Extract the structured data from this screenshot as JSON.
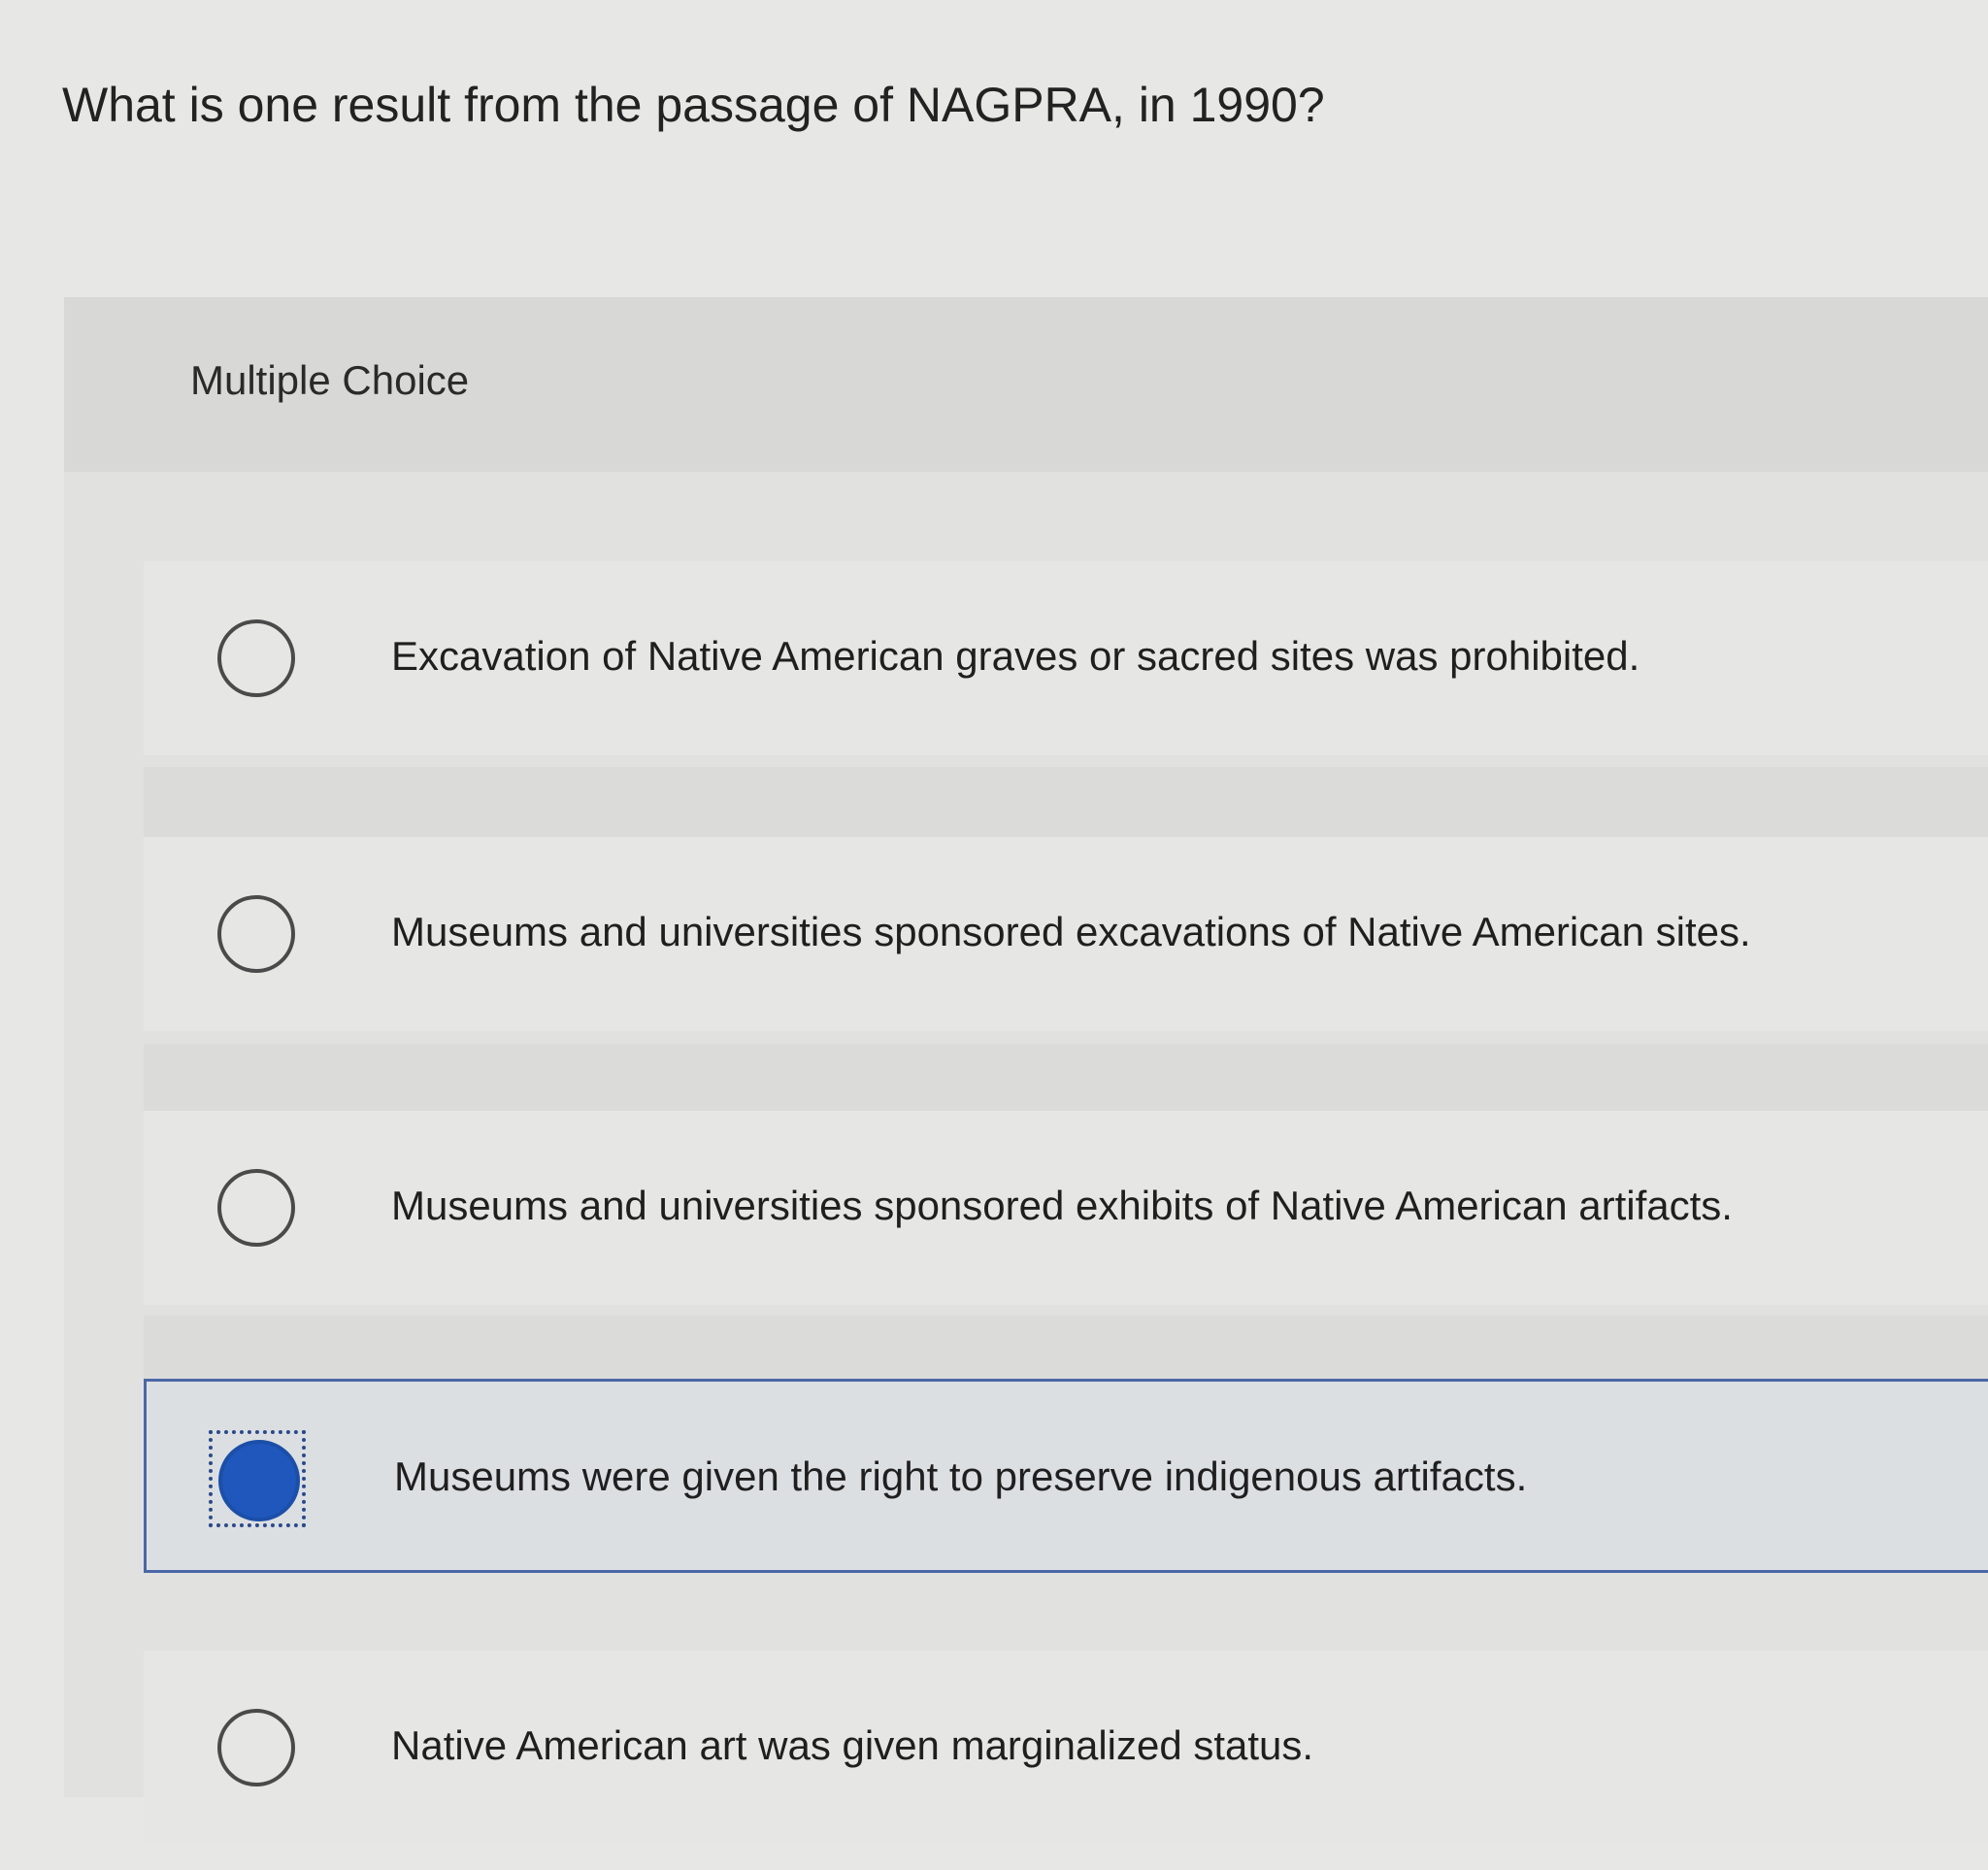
{
  "question": {
    "text": "What is one result from the passage of NAGPRA, in 1990?"
  },
  "panel": {
    "type_label": "Multiple Choice"
  },
  "options": [
    {
      "text": "Excavation of Native American graves or sacred sites was prohibited.",
      "selected": false
    },
    {
      "text": "Museums and universities sponsored excavations of Native American sites.",
      "selected": false
    },
    {
      "text": "Museums and universities sponsored exhibits of Native American artifacts.",
      "selected": false
    },
    {
      "text": "Museums were given the right to preserve indigenous artifacts.",
      "selected": true
    },
    {
      "text": "Native American art was given marginalized status.",
      "selected": false
    }
  ],
  "colors": {
    "selected_accent": "#1f57bc",
    "selected_border": "#4b67a6"
  }
}
